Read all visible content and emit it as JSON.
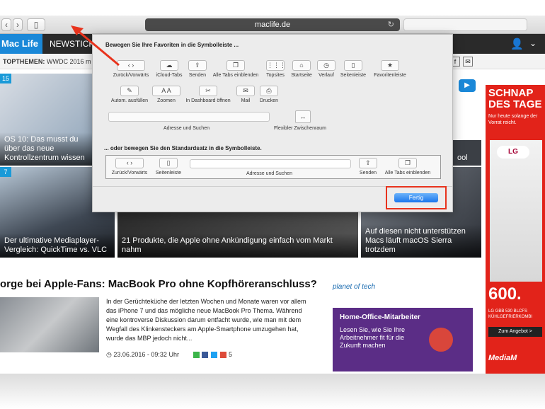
{
  "browser": {
    "url": "maclife.de"
  },
  "site": {
    "logo": "Mac Life",
    "nav": "NEWSTICKE",
    "topics_label": "TOPTHEMEN:",
    "topics_item": "WWDC 2016  m",
    "tiles": [
      {
        "badge": "15",
        "caption": "OS 10: Das musst du über das neue Kontrollzentrum wissen"
      },
      {
        "badge": "7",
        "caption": "Der ultimative Mediaplayer-Vergleich: QuickTime vs. VLC"
      },
      {
        "caption": "21 Produkte, die Apple ohne Ankündigung einfach vom Markt nahm"
      },
      {
        "caption": "Auf diesen nicht unterstützen Macs läuft macOS Sierra trotzdem"
      },
      {
        "caption": "ool"
      }
    ],
    "headline": "orge bei Apple-Fans: MacBook Pro ohne Kopfhöreranschluss?",
    "article_body": "In der Gerüchteküche der letzten Wochen und Monate waren vor allem das iPhone 7 und das mögliche neue MacBook Pro Thema. Während eine kontroverse Diskussion darum entfacht wurde, wie man mit dem Wegfall des Klinkensteckers am Apple-Smartphone umzugehen hat, wurde das MBP jedoch nicht...",
    "article_date": "23.06.2016 - 09:32 Uhr",
    "comment_count": "5",
    "planet_logo": "planet of tech",
    "ad_purple": {
      "title": "Home-Office-Mitarbeiter",
      "body": "Lesen Sie, wie Sie Ihre Arbeitnehmer fit für die Zukunft machen"
    },
    "ad_mediamarkt": {
      "headline": "SCHNAP DES TAGE",
      "sub": "Nur heute solange der Vorrat reicht.",
      "brand_logo": "LG",
      "price": "600.",
      "model": "LG GBB 530 BLCFS KÜHLGEFRIERKOMBI",
      "button": "Zum Angebot >",
      "brand": "MediaM"
    }
  },
  "sheet": {
    "title": "Bewegen Sie Ihre Favoriten in die Symbolleiste ...",
    "row1": [
      {
        "icon": "back-forward-icon",
        "glyph": "‹ ›",
        "label": "Zurück/Vorwärts"
      },
      {
        "icon": "icloud-icon",
        "glyph": "☁",
        "label": "iCloud-Tabs"
      },
      {
        "icon": "share-icon",
        "glyph": "⇪",
        "label": "Senden"
      },
      {
        "icon": "all-tabs-icon",
        "glyph": "❐",
        "label": "Alle Tabs einblenden"
      },
      {
        "icon": "topsites-icon",
        "glyph": "⋮⋮⋮",
        "label": "Topsites"
      },
      {
        "icon": "home-icon",
        "glyph": "⌂",
        "label": "Startseite"
      },
      {
        "icon": "history-icon",
        "glyph": "◷",
        "label": "Verlauf"
      },
      {
        "icon": "sidebar-icon",
        "glyph": "▯",
        "label": "Seitenleiste"
      },
      {
        "icon": "bookmarks-bar-icon",
        "glyph": "★",
        "label": "Favoritenleiste"
      }
    ],
    "row2": [
      {
        "icon": "autofill-icon",
        "glyph": "✎",
        "label": "Autom. ausfüllen"
      },
      {
        "icon": "zoom-icon",
        "glyph": "A A",
        "label": "Zoomen"
      },
      {
        "icon": "dashboard-icon",
        "glyph": "✂",
        "label": "In Dashboard öffnen"
      },
      {
        "icon": "mail-icon",
        "glyph": "✉",
        "label": "Mail"
      },
      {
        "icon": "print-icon",
        "glyph": "⎙",
        "label": "Drucken"
      }
    ],
    "address_label": "Adresse und Suchen",
    "flex_label": "Flexibler Zwischenraum",
    "subtitle": "... oder bewegen Sie den Standardsatz in die Symbolleiste.",
    "default_set": [
      {
        "icon": "back-forward-icon",
        "glyph": "‹ ›",
        "label": "Zurück/Vorwärts"
      },
      {
        "icon": "sidebar-icon",
        "glyph": "▯",
        "label": "Seitenleiste"
      },
      {
        "icon": "share-icon",
        "glyph": "⇪",
        "label": "Senden"
      },
      {
        "icon": "all-tabs-icon",
        "glyph": "❐",
        "label": "Alle Tabs einblenden"
      }
    ],
    "default_address_label": "Adresse und Suchen",
    "done": "Fertig"
  },
  "colors": {
    "highlight": "#e8331d",
    "accent": "#1976ed"
  }
}
